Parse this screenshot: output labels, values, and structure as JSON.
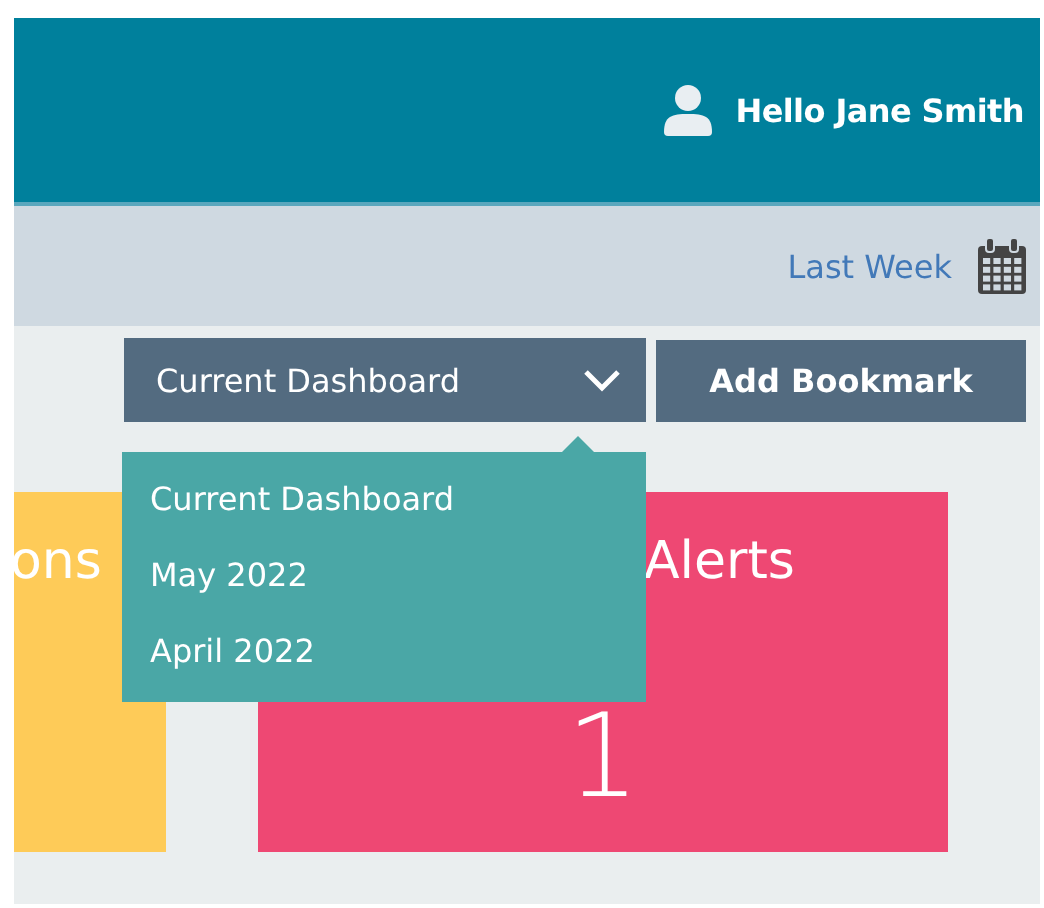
{
  "header": {
    "greeting": "Hello Jane Smith"
  },
  "date_bar": {
    "range": "Last Week"
  },
  "toolbar": {
    "dashboard_select": {
      "value": "Current Dashboard",
      "options": [
        "Current Dashboard",
        "May 2022",
        "April 2022"
      ]
    },
    "bookmark_button": "Add Bookmark"
  },
  "cards": [
    {
      "title": "ons",
      "color": "#fecb58"
    },
    {
      "title": "Alerts",
      "value": "1",
      "color": "#ee4873"
    }
  ]
}
